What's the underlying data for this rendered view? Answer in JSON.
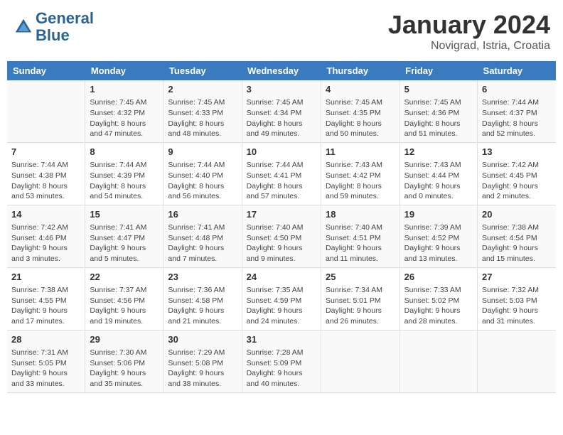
{
  "header": {
    "logo_line1": "General",
    "logo_line2": "Blue",
    "month": "January 2024",
    "location": "Novigrad, Istria, Croatia"
  },
  "columns": [
    "Sunday",
    "Monday",
    "Tuesday",
    "Wednesday",
    "Thursday",
    "Friday",
    "Saturday"
  ],
  "weeks": [
    [
      {
        "day": "",
        "info": ""
      },
      {
        "day": "1",
        "info": "Sunrise: 7:45 AM\nSunset: 4:32 PM\nDaylight: 8 hours\nand 47 minutes."
      },
      {
        "day": "2",
        "info": "Sunrise: 7:45 AM\nSunset: 4:33 PM\nDaylight: 8 hours\nand 48 minutes."
      },
      {
        "day": "3",
        "info": "Sunrise: 7:45 AM\nSunset: 4:34 PM\nDaylight: 8 hours\nand 49 minutes."
      },
      {
        "day": "4",
        "info": "Sunrise: 7:45 AM\nSunset: 4:35 PM\nDaylight: 8 hours\nand 50 minutes."
      },
      {
        "day": "5",
        "info": "Sunrise: 7:45 AM\nSunset: 4:36 PM\nDaylight: 8 hours\nand 51 minutes."
      },
      {
        "day": "6",
        "info": "Sunrise: 7:44 AM\nSunset: 4:37 PM\nDaylight: 8 hours\nand 52 minutes."
      }
    ],
    [
      {
        "day": "7",
        "info": "Sunrise: 7:44 AM\nSunset: 4:38 PM\nDaylight: 8 hours\nand 53 minutes."
      },
      {
        "day": "8",
        "info": "Sunrise: 7:44 AM\nSunset: 4:39 PM\nDaylight: 8 hours\nand 54 minutes."
      },
      {
        "day": "9",
        "info": "Sunrise: 7:44 AM\nSunset: 4:40 PM\nDaylight: 8 hours\nand 56 minutes."
      },
      {
        "day": "10",
        "info": "Sunrise: 7:44 AM\nSunset: 4:41 PM\nDaylight: 8 hours\nand 57 minutes."
      },
      {
        "day": "11",
        "info": "Sunrise: 7:43 AM\nSunset: 4:42 PM\nDaylight: 8 hours\nand 59 minutes."
      },
      {
        "day": "12",
        "info": "Sunrise: 7:43 AM\nSunset: 4:44 PM\nDaylight: 9 hours\nand 0 minutes."
      },
      {
        "day": "13",
        "info": "Sunrise: 7:42 AM\nSunset: 4:45 PM\nDaylight: 9 hours\nand 2 minutes."
      }
    ],
    [
      {
        "day": "14",
        "info": "Sunrise: 7:42 AM\nSunset: 4:46 PM\nDaylight: 9 hours\nand 3 minutes."
      },
      {
        "day": "15",
        "info": "Sunrise: 7:41 AM\nSunset: 4:47 PM\nDaylight: 9 hours\nand 5 minutes."
      },
      {
        "day": "16",
        "info": "Sunrise: 7:41 AM\nSunset: 4:48 PM\nDaylight: 9 hours\nand 7 minutes."
      },
      {
        "day": "17",
        "info": "Sunrise: 7:40 AM\nSunset: 4:50 PM\nDaylight: 9 hours\nand 9 minutes."
      },
      {
        "day": "18",
        "info": "Sunrise: 7:40 AM\nSunset: 4:51 PM\nDaylight: 9 hours\nand 11 minutes."
      },
      {
        "day": "19",
        "info": "Sunrise: 7:39 AM\nSunset: 4:52 PM\nDaylight: 9 hours\nand 13 minutes."
      },
      {
        "day": "20",
        "info": "Sunrise: 7:38 AM\nSunset: 4:54 PM\nDaylight: 9 hours\nand 15 minutes."
      }
    ],
    [
      {
        "day": "21",
        "info": "Sunrise: 7:38 AM\nSunset: 4:55 PM\nDaylight: 9 hours\nand 17 minutes."
      },
      {
        "day": "22",
        "info": "Sunrise: 7:37 AM\nSunset: 4:56 PM\nDaylight: 9 hours\nand 19 minutes."
      },
      {
        "day": "23",
        "info": "Sunrise: 7:36 AM\nSunset: 4:58 PM\nDaylight: 9 hours\nand 21 minutes."
      },
      {
        "day": "24",
        "info": "Sunrise: 7:35 AM\nSunset: 4:59 PM\nDaylight: 9 hours\nand 24 minutes."
      },
      {
        "day": "25",
        "info": "Sunrise: 7:34 AM\nSunset: 5:01 PM\nDaylight: 9 hours\nand 26 minutes."
      },
      {
        "day": "26",
        "info": "Sunrise: 7:33 AM\nSunset: 5:02 PM\nDaylight: 9 hours\nand 28 minutes."
      },
      {
        "day": "27",
        "info": "Sunrise: 7:32 AM\nSunset: 5:03 PM\nDaylight: 9 hours\nand 31 minutes."
      }
    ],
    [
      {
        "day": "28",
        "info": "Sunrise: 7:31 AM\nSunset: 5:05 PM\nDaylight: 9 hours\nand 33 minutes."
      },
      {
        "day": "29",
        "info": "Sunrise: 7:30 AM\nSunset: 5:06 PM\nDaylight: 9 hours\nand 35 minutes."
      },
      {
        "day": "30",
        "info": "Sunrise: 7:29 AM\nSunset: 5:08 PM\nDaylight: 9 hours\nand 38 minutes."
      },
      {
        "day": "31",
        "info": "Sunrise: 7:28 AM\nSunset: 5:09 PM\nDaylight: 9 hours\nand 40 minutes."
      },
      {
        "day": "",
        "info": ""
      },
      {
        "day": "",
        "info": ""
      },
      {
        "day": "",
        "info": ""
      }
    ]
  ]
}
